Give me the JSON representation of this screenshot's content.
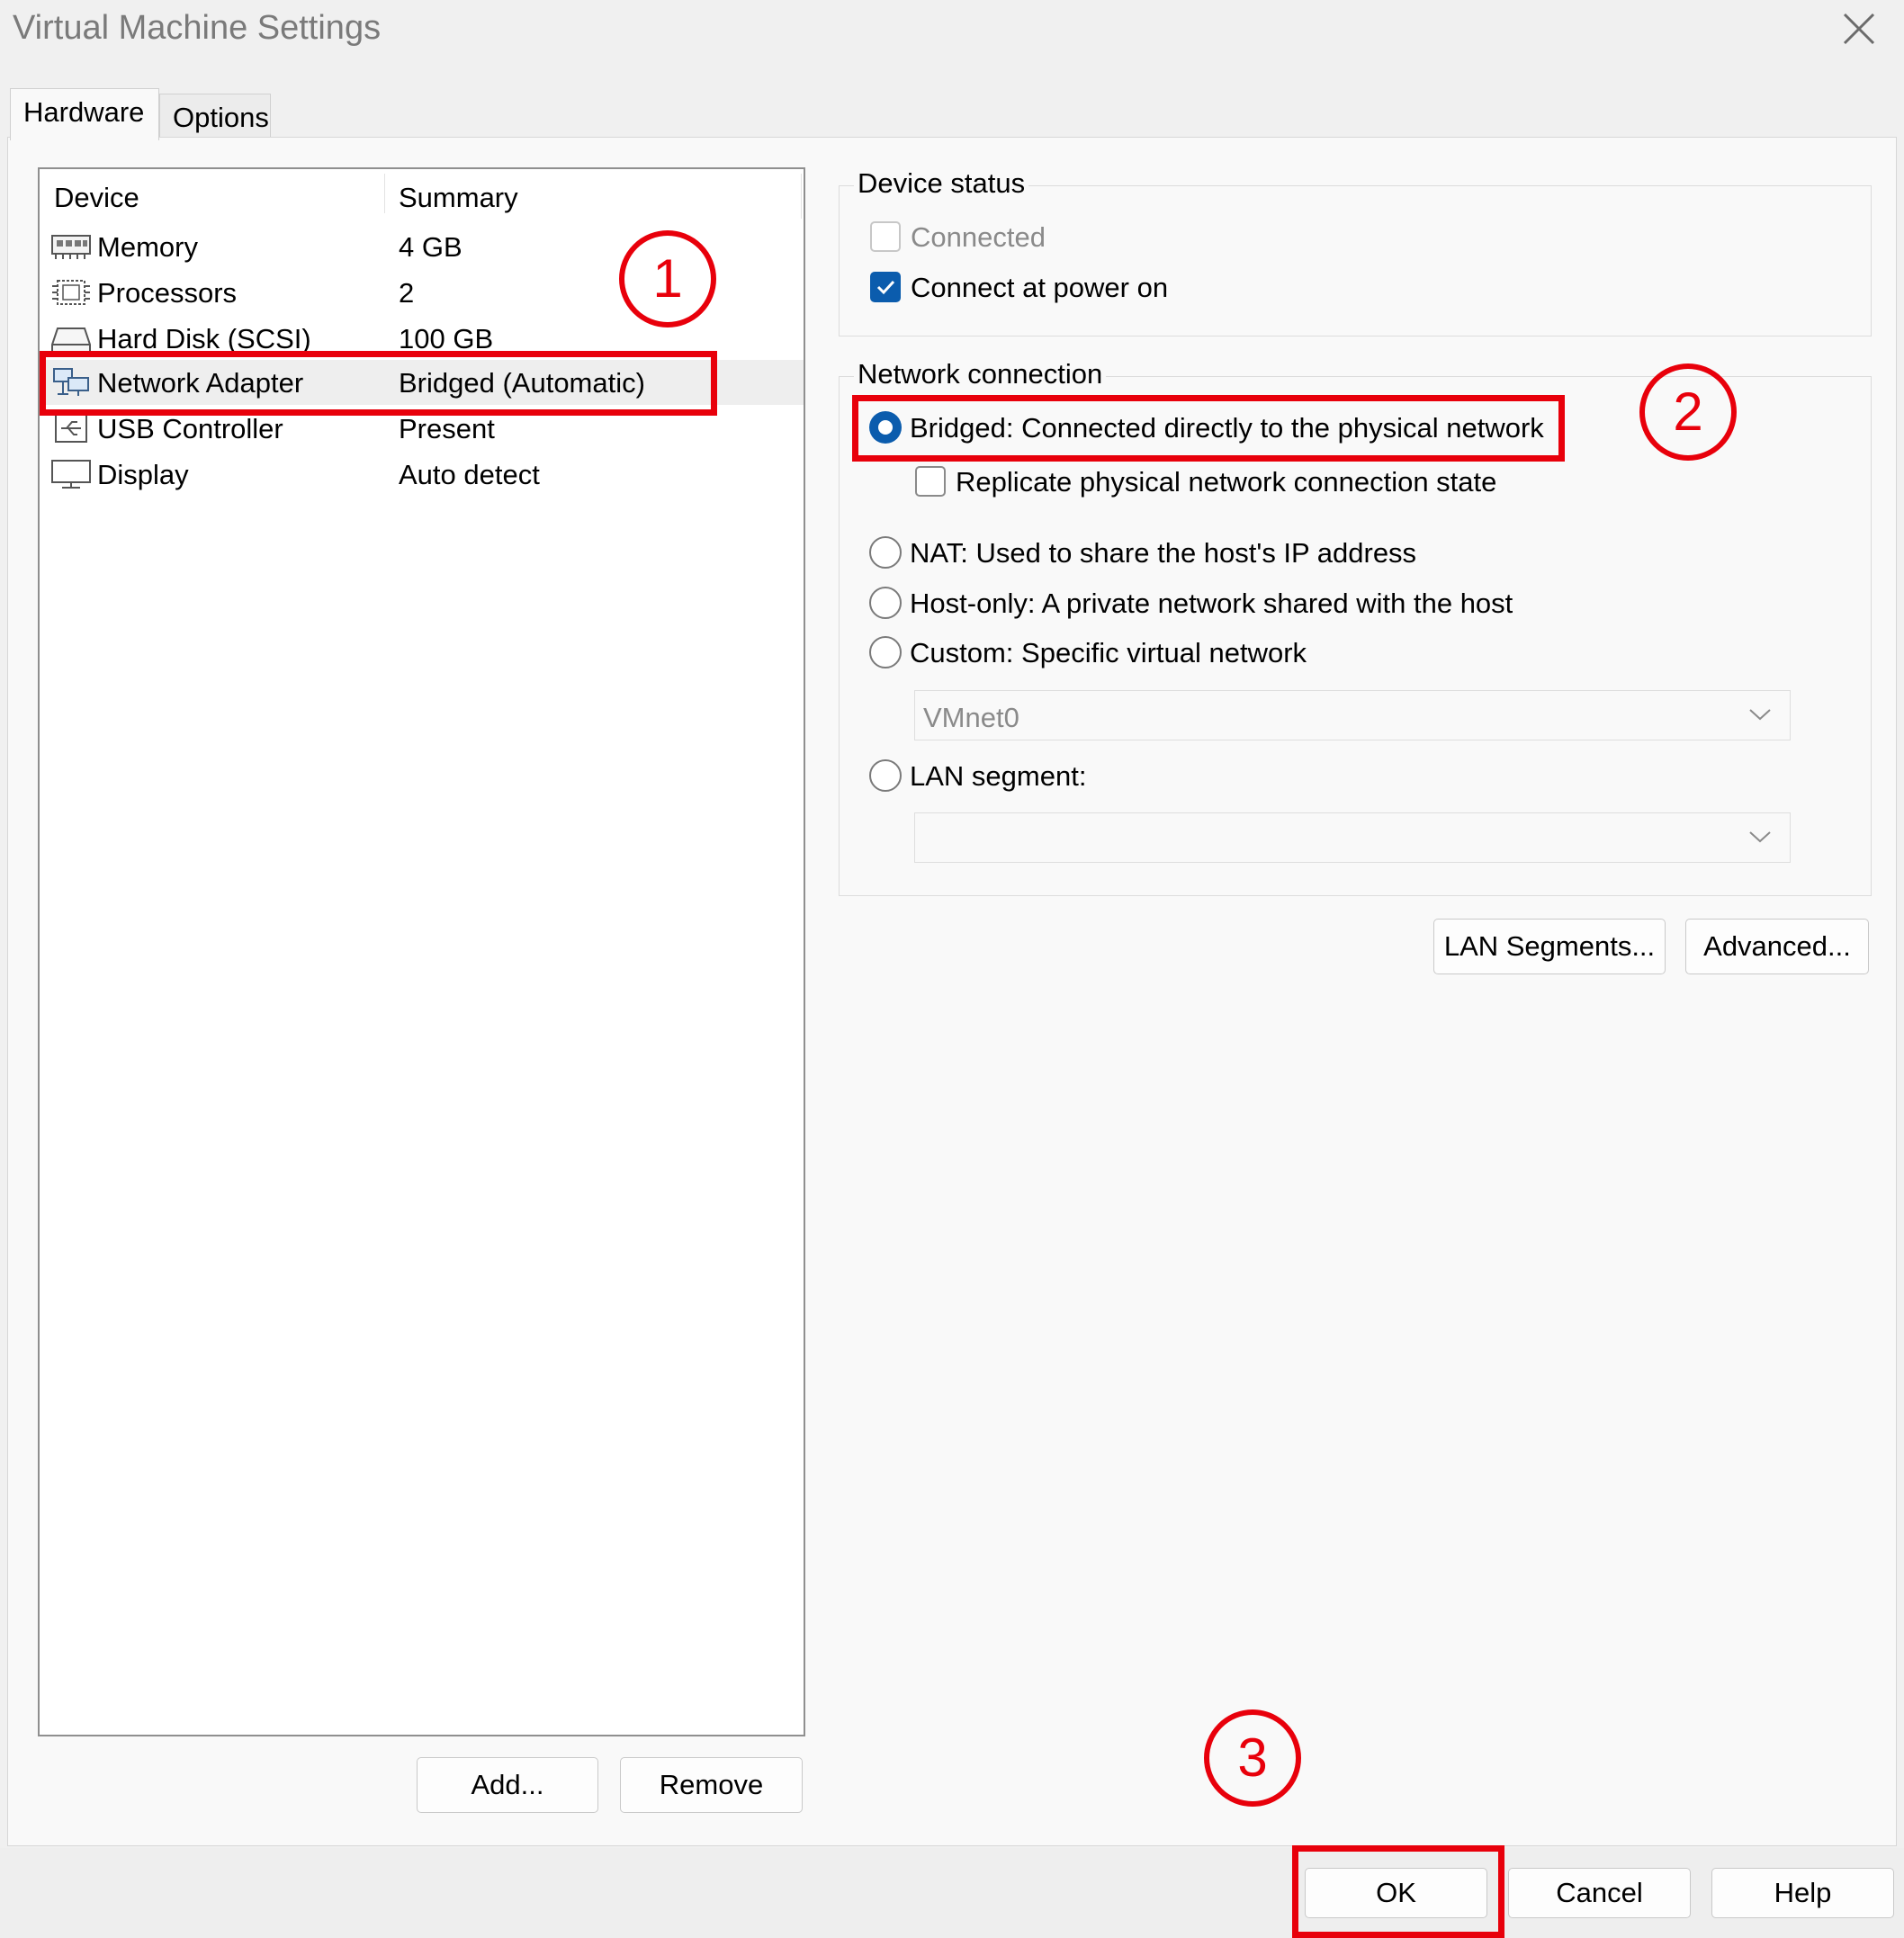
{
  "window": {
    "title": "Virtual Machine Settings"
  },
  "tabs": [
    {
      "label": "Hardware",
      "active": true
    },
    {
      "label": "Options",
      "active": false
    }
  ],
  "device_list": {
    "headers": {
      "device": "Device",
      "summary": "Summary"
    },
    "rows": [
      {
        "icon": "memory-icon",
        "name": "Memory",
        "summary": "4 GB"
      },
      {
        "icon": "processor-icon",
        "name": "Processors",
        "summary": "2"
      },
      {
        "icon": "hard-disk-icon",
        "name": "Hard Disk (SCSI)",
        "summary": "100 GB"
      },
      {
        "icon": "network-adapter-icon",
        "name": "Network Adapter",
        "summary": "Bridged (Automatic)",
        "selected": true
      },
      {
        "icon": "usb-icon",
        "name": "USB Controller",
        "summary": "Present"
      },
      {
        "icon": "display-icon",
        "name": "Display",
        "summary": "Auto detect"
      }
    ],
    "add_label": "Add...",
    "remove_label": "Remove"
  },
  "device_status": {
    "legend": "Device status",
    "connected": {
      "label": "Connected",
      "checked": false,
      "enabled": false
    },
    "connect_at_power_on": {
      "label": "Connect at power on",
      "checked": true
    }
  },
  "network_connection": {
    "legend": "Network connection",
    "bridged": {
      "label": "Bridged: Connected directly to the physical network",
      "selected": true
    },
    "replicate": {
      "label": "Replicate physical network connection state",
      "checked": false
    },
    "nat": {
      "label": "NAT: Used to share the host's IP address"
    },
    "host_only": {
      "label": "Host-only: A private network shared with the host"
    },
    "custom": {
      "label": "Custom: Specific virtual network",
      "value": "VMnet0"
    },
    "lan_segment": {
      "label": "LAN segment:",
      "value": ""
    }
  },
  "buttons": {
    "lan_segments": "LAN Segments...",
    "advanced": "Advanced...",
    "ok": "OK",
    "cancel": "Cancel",
    "help": "Help"
  },
  "annotations": {
    "step1": "1",
    "step2": "2",
    "step3": "3",
    "color": "#e8000b"
  }
}
